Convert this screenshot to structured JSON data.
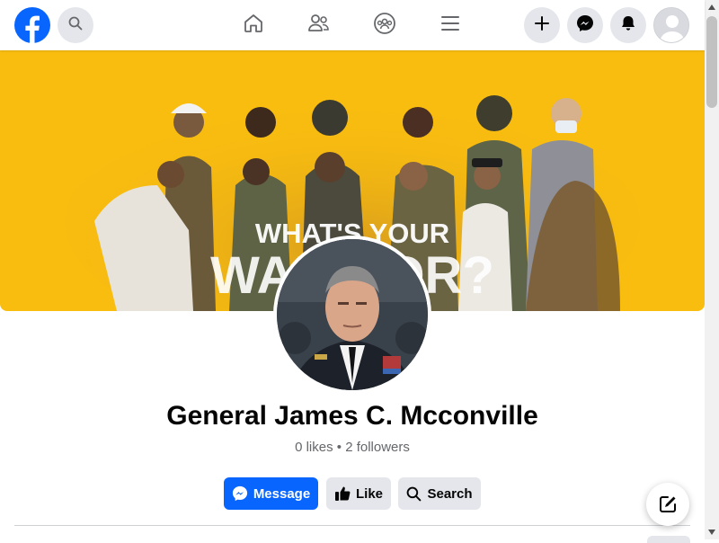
{
  "colors": {
    "brand": "#0866ff",
    "cover_background": "#f9bd10",
    "button_secondary": "#e4e6eb",
    "text_primary": "#050505",
    "text_secondary": "#65676b"
  },
  "topbar": {
    "logo_icon": "facebook-logo-icon",
    "search_icon": "search-icon",
    "nav": [
      {
        "name": "home",
        "icon": "home-icon"
      },
      {
        "name": "friends",
        "icon": "friends-icon"
      },
      {
        "name": "groups",
        "icon": "groups-icon"
      },
      {
        "name": "menu",
        "icon": "hamburger-menu-icon"
      }
    ],
    "actions": [
      {
        "name": "create",
        "icon": "plus-icon"
      },
      {
        "name": "messenger",
        "icon": "messenger-icon"
      },
      {
        "name": "notifications",
        "icon": "bell-icon"
      },
      {
        "name": "account",
        "icon": "avatar-icon"
      }
    ]
  },
  "cover": {
    "headline_line1": "WHAT'S YOUR",
    "headline_line2": "WARRIOR?"
  },
  "profile": {
    "name": "General James C. Mcconville",
    "stats": "0 likes • 2 followers"
  },
  "actions": {
    "message_label": "Message",
    "like_label": "Like",
    "search_label": "Search"
  },
  "floating": {
    "compose_icon": "compose-icon"
  }
}
